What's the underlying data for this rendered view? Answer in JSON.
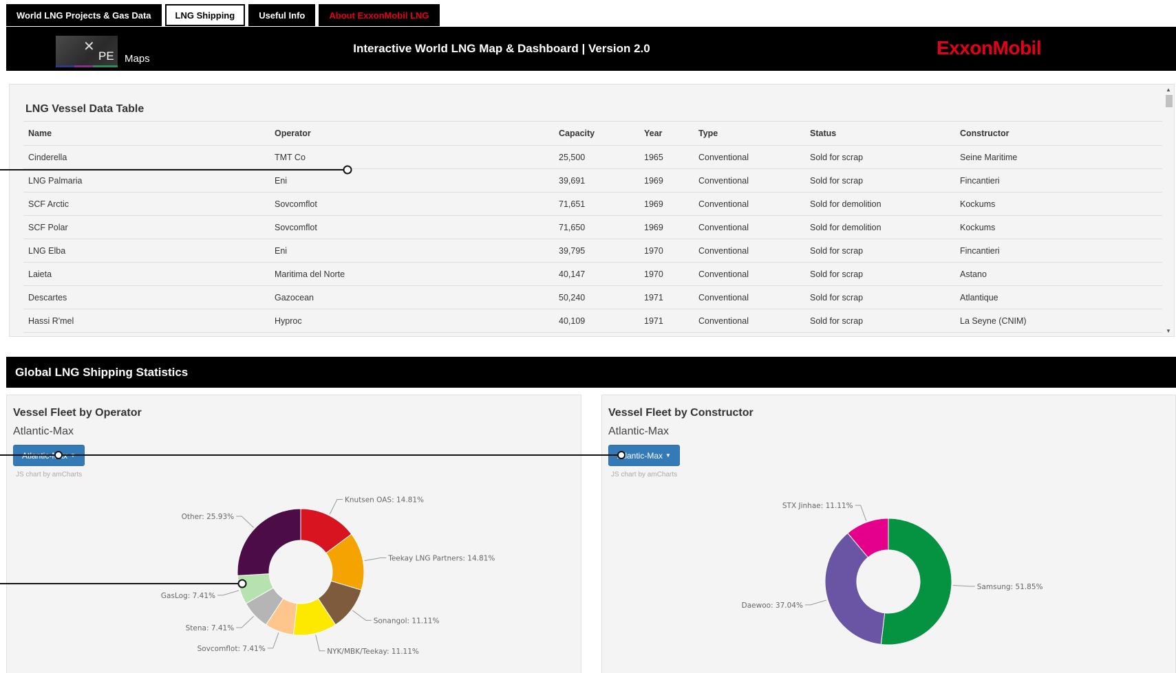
{
  "nav": {
    "items": [
      {
        "label": "World LNG Projects & Gas Data",
        "active": false
      },
      {
        "label": "LNG Shipping",
        "active": true
      },
      {
        "label": "Useful Info",
        "active": false
      },
      {
        "label": "About ExxonMobil LNG",
        "active": false
      }
    ]
  },
  "header": {
    "logo_pe": "PE",
    "logo_maps": "Maps",
    "title": "Interactive World LNG Map & Dashboard | Version 2.0",
    "brand": "ExxonMobil"
  },
  "vessel_table": {
    "title": "LNG Vessel Data Table",
    "columns": [
      "Name",
      "Operator",
      "Capacity",
      "Year",
      "Type",
      "Status",
      "Constructor"
    ],
    "rows": [
      [
        "Cinderella",
        "TMT Co",
        "25,500",
        "1965",
        "Conventional",
        "Sold for scrap",
        "Seine Maritime"
      ],
      [
        "LNG Palmaria",
        "Eni",
        "39,691",
        "1969",
        "Conventional",
        "Sold for scrap",
        "Fincantieri"
      ],
      [
        "SCF Arctic",
        "Sovcomflot",
        "71,651",
        "1969",
        "Conventional",
        "Sold for demolition",
        "Kockums"
      ],
      [
        "SCF Polar",
        "Sovcomflot",
        "71,650",
        "1969",
        "Conventional",
        "Sold for demolition",
        "Kockums"
      ],
      [
        "LNG Elba",
        "Eni",
        "39,795",
        "1970",
        "Conventional",
        "Sold for scrap",
        "Fincantieri"
      ],
      [
        "Laieta",
        "Maritima del Norte",
        "40,147",
        "1970",
        "Conventional",
        "Sold for scrap",
        "Astano"
      ],
      [
        "Descartes",
        "Gazocean",
        "50,240",
        "1971",
        "Conventional",
        "Sold for scrap",
        "Atlantique"
      ],
      [
        "Hassi R'mel",
        "Hyproc",
        "40,109",
        "1971",
        "Conventional",
        "Sold for scrap",
        "La Seyne (CNIM)"
      ]
    ]
  },
  "stats": {
    "title": "Global LNG Shipping Statistics"
  },
  "charts": {
    "operator": {
      "title": "Vessel Fleet by Operator",
      "subtitle": "Atlantic-Max",
      "dropdown_label": "Atlantic-Max",
      "credit": "JS chart by amCharts"
    },
    "constructor": {
      "title": "Vessel Fleet by Constructor",
      "subtitle": "Atlantic-Max",
      "dropdown_label": "Atlantic-Max",
      "credit": "JS chart by amCharts"
    }
  },
  "chart_data": [
    {
      "type": "pie",
      "title": "Vessel Fleet by Operator",
      "subtitle": "Atlantic-Max",
      "slices": [
        {
          "label": "Knutsen OAS",
          "value": 14.81,
          "color": "#d7141f"
        },
        {
          "label": "Teekay LNG Partners",
          "value": 14.81,
          "color": "#f5a300"
        },
        {
          "label": "Sonangol",
          "value": 11.11,
          "color": "#7f5b3e"
        },
        {
          "label": "NYK/MBK/Teekay",
          "value": 11.11,
          "color": "#fde800"
        },
        {
          "label": "Sovcomflot",
          "value": 7.41,
          "color": "#fec68d"
        },
        {
          "label": "Stena",
          "value": 7.41,
          "color": "#b5b5b5"
        },
        {
          "label": "GasLog",
          "value": 7.41,
          "color": "#b6e2b0"
        },
        {
          "label": "Other",
          "value": 25.93,
          "color": "#4b0c47"
        }
      ]
    },
    {
      "type": "pie",
      "title": "Vessel Fleet by Constructor",
      "subtitle": "Atlantic-Max",
      "slices": [
        {
          "label": "Samsung",
          "value": 51.85,
          "color": "#059241"
        },
        {
          "label": "Daewoo",
          "value": 37.04,
          "color": "#6a55a4"
        },
        {
          "label": "STX Jinhae",
          "value": 11.11,
          "color": "#e4008a"
        }
      ]
    }
  ]
}
